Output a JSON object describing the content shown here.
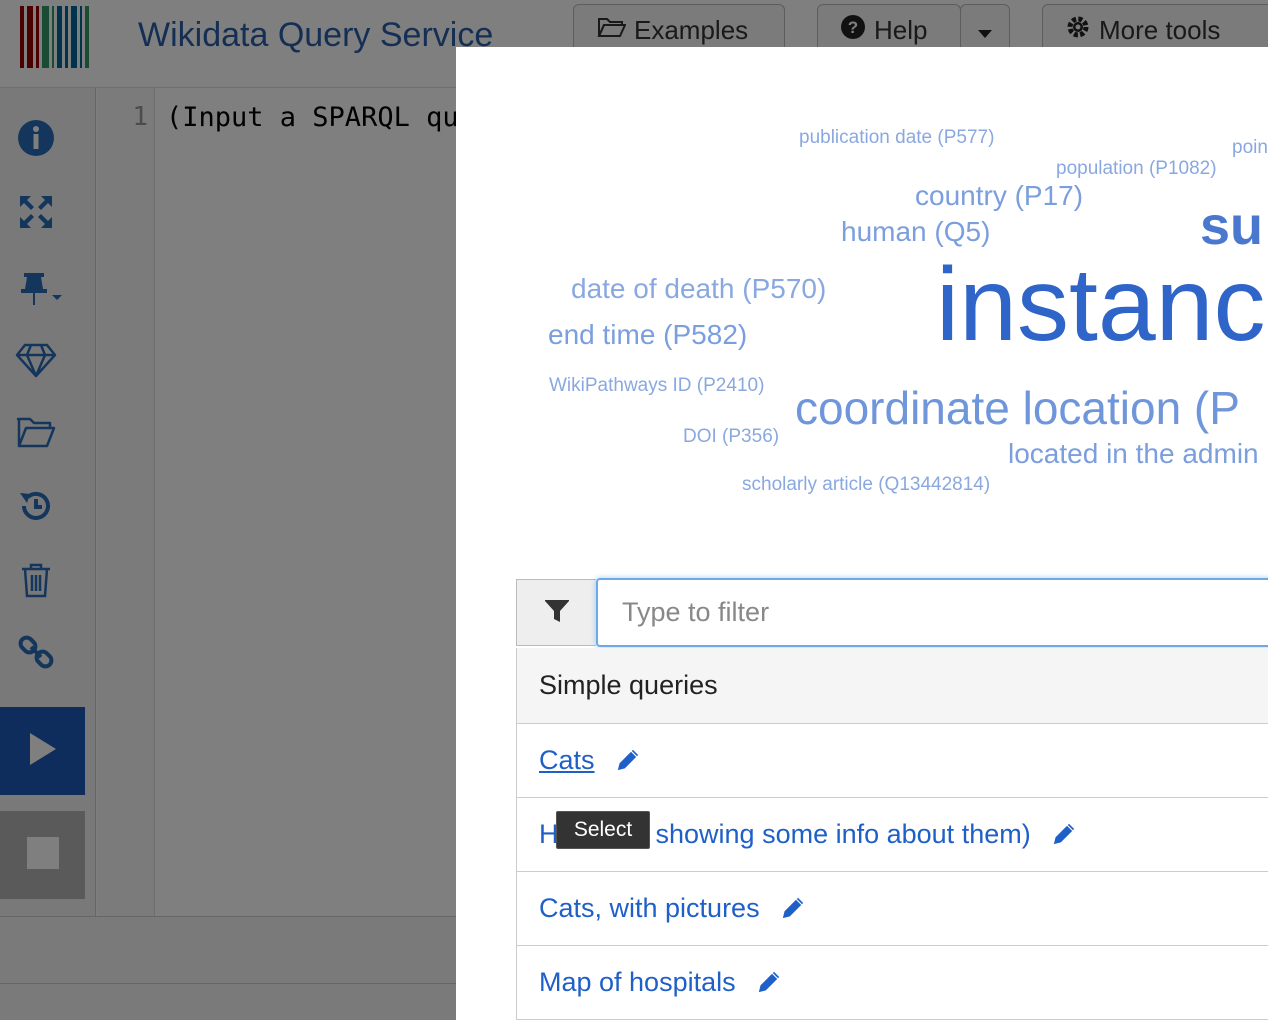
{
  "header": {
    "title": "Wikidata Query Service",
    "logo_colors": [
      "#990000",
      "#990000",
      "#990000",
      "#339966",
      "#339966",
      "#006699",
      "#006699",
      "#006699",
      "#006699",
      "#339966"
    ],
    "buttons": {
      "examples": "Examples",
      "help": "Help",
      "more_tools": "More tools"
    }
  },
  "sidebar": {
    "icons": [
      "info-icon",
      "expand-icon",
      "pin-icon",
      "diamond-icon",
      "folder-icon",
      "history-icon",
      "trash-icon",
      "link-icon"
    ],
    "run_icon": "play-icon",
    "stop_icon": "stop-icon",
    "accent": "#2a6cb8"
  },
  "editor": {
    "line_number": "1",
    "line_text": "(Input a SPARQL qu"
  },
  "modal": {
    "word_cloud": [
      {
        "text": "publication date (P577)"
      },
      {
        "text": "poin"
      },
      {
        "text": "population (P1082)"
      },
      {
        "text": "country (P17)"
      },
      {
        "text": "su"
      },
      {
        "text": "human (Q5)"
      },
      {
        "text": "date of death (P570)"
      },
      {
        "text": "instanc"
      },
      {
        "text": "end time (P582)"
      },
      {
        "text": "WikiPathways ID (P2410)"
      },
      {
        "text": "coordinate location (P"
      },
      {
        "text": "DOI (P356)"
      },
      {
        "text": "located in the admin"
      },
      {
        "text": "scholarly article (Q13442814)"
      }
    ],
    "filter": {
      "placeholder": "Type to filter",
      "value": "",
      "icon": "filter-icon"
    },
    "list": {
      "header": "Simple queries",
      "items": [
        {
          "label": "Cats"
        },
        {
          "label": "H",
          "label_rest": "showing some info about them)"
        },
        {
          "label": "Cats, with pictures"
        },
        {
          "label": "Map of hospitals"
        }
      ]
    },
    "tooltip": "Select",
    "link_color": "#1f5fc8"
  }
}
